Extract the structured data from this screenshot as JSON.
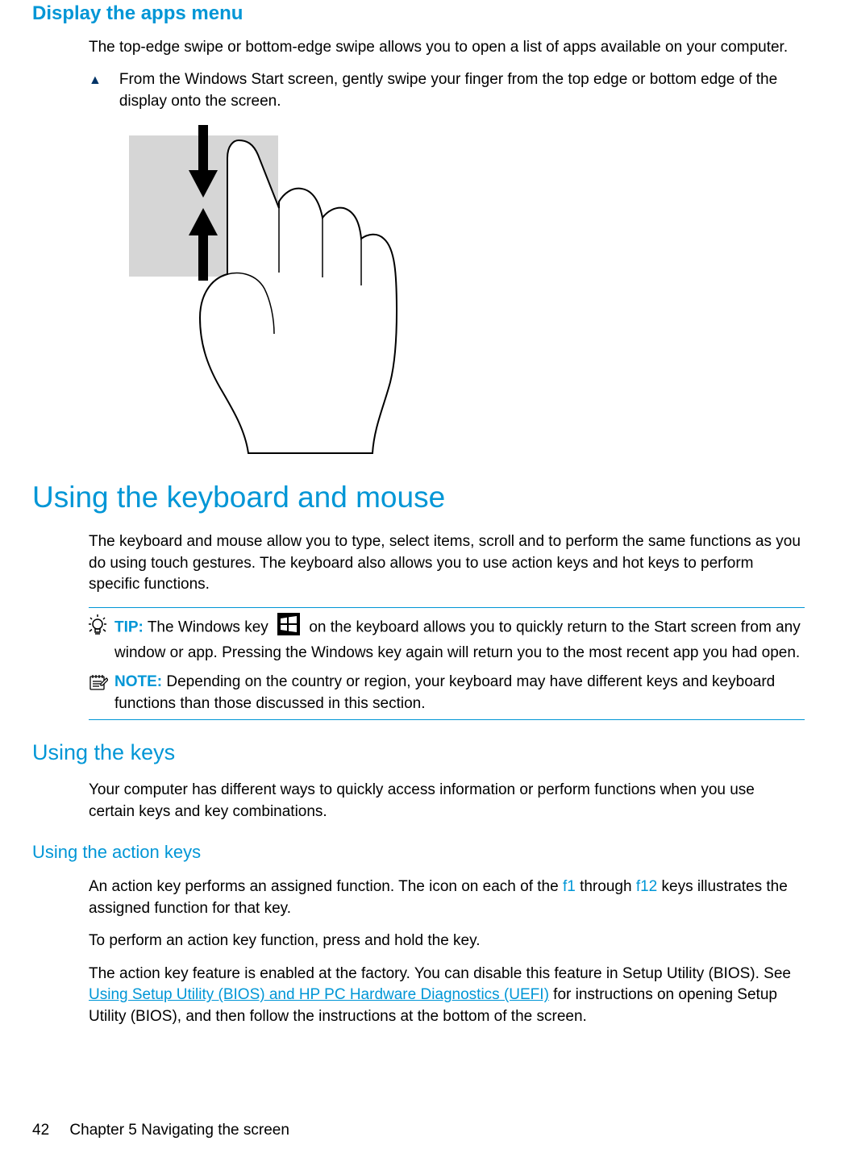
{
  "section1": {
    "heading": "Display the apps menu",
    "para": "The top-edge swipe or bottom-edge swipe allows you to open a list of apps available on your computer.",
    "step_marker": "▲",
    "step_text": "From the Windows Start screen, gently swipe your finger from the top edge or bottom edge of the display onto the screen."
  },
  "section2": {
    "heading": "Using the keyboard and mouse",
    "para": "The keyboard and mouse allow you to type, select items, scroll and to perform the same functions as you do using touch gestures. The keyboard also allows you to use action keys and hot keys to perform specific functions."
  },
  "tip": {
    "label": "TIP:",
    "text_before": "The Windows key",
    "text_after": "on the keyboard allows you to quickly return to the Start screen from any window or app. Pressing the Windows key again will return you to the most recent app you had open."
  },
  "note": {
    "label": "NOTE:",
    "text": "Depending on the country or region, your keyboard may have different keys and keyboard functions than those discussed in this section."
  },
  "section3": {
    "heading": "Using the keys",
    "para": "Your computer has different ways to quickly access information or perform functions when you use certain keys and key combinations."
  },
  "section4": {
    "heading": "Using the action keys",
    "para1_a": "An action key performs an assigned function. The icon on each of the ",
    "f1": "f1",
    "para1_b": " through ",
    "f12": "f12",
    "para1_c": " keys illustrates the assigned function for that key.",
    "para2": "To perform an action key function, press and hold the key.",
    "para3_a": "The action key feature is enabled at the factory. You can disable this feature in Setup Utility (BIOS). See ",
    "link": "Using Setup Utility (BIOS) and HP PC Hardware Diagnostics (UEFI)",
    "para3_b": " for instructions on opening Setup Utility (BIOS), and then follow the instructions at the bottom of the screen."
  },
  "footer": {
    "page": "42",
    "chapter": "Chapter 5   Navigating the screen"
  }
}
